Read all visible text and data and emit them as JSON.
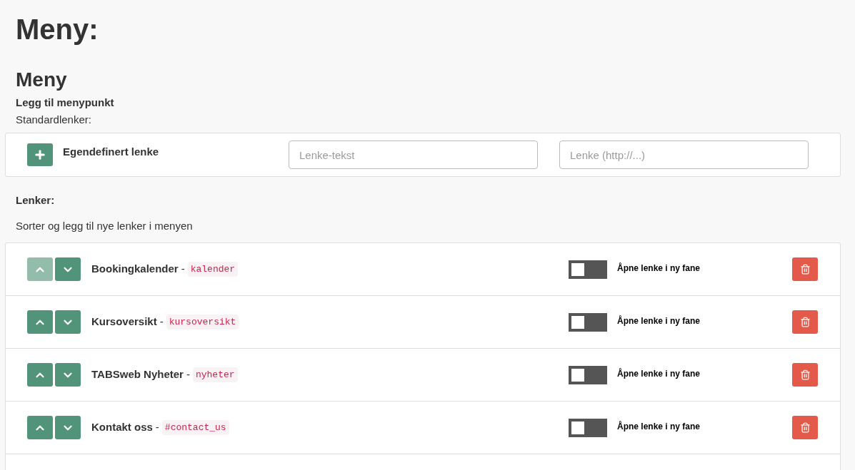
{
  "page_title": "Meny:",
  "section_title": "Meny",
  "add_heading": "Legg til menypunkt",
  "standard_label": "Standardlenker:",
  "custom_link": {
    "label": "Egendefinert lenke",
    "text_placeholder": "Lenke-tekst",
    "url_placeholder": "Lenke (http://...)"
  },
  "links_heading": "Lenker:",
  "links_description": "Sorter og legg til nye lenker i menyen",
  "links": [
    {
      "name": "Bookingkalender",
      "separator": "-",
      "slug": "kalender",
      "up_disabled": true,
      "new_tab": false,
      "new_tab_label": "Åpne lenke i ny fane"
    },
    {
      "name": "Kursoversikt",
      "separator": "-",
      "slug": "kursoversikt",
      "up_disabled": false,
      "new_tab": false,
      "new_tab_label": "Åpne lenke i ny fane"
    },
    {
      "name": "TABSweb Nyheter",
      "separator": "-",
      "slug": "nyheter",
      "up_disabled": false,
      "new_tab": false,
      "new_tab_label": "Åpne lenke i ny fane"
    },
    {
      "name": "Kontakt oss",
      "separator": "-",
      "slug": "#contact_us",
      "up_disabled": false,
      "new_tab": false,
      "new_tab_label": "Åpne lenke i ny fane"
    }
  ]
}
